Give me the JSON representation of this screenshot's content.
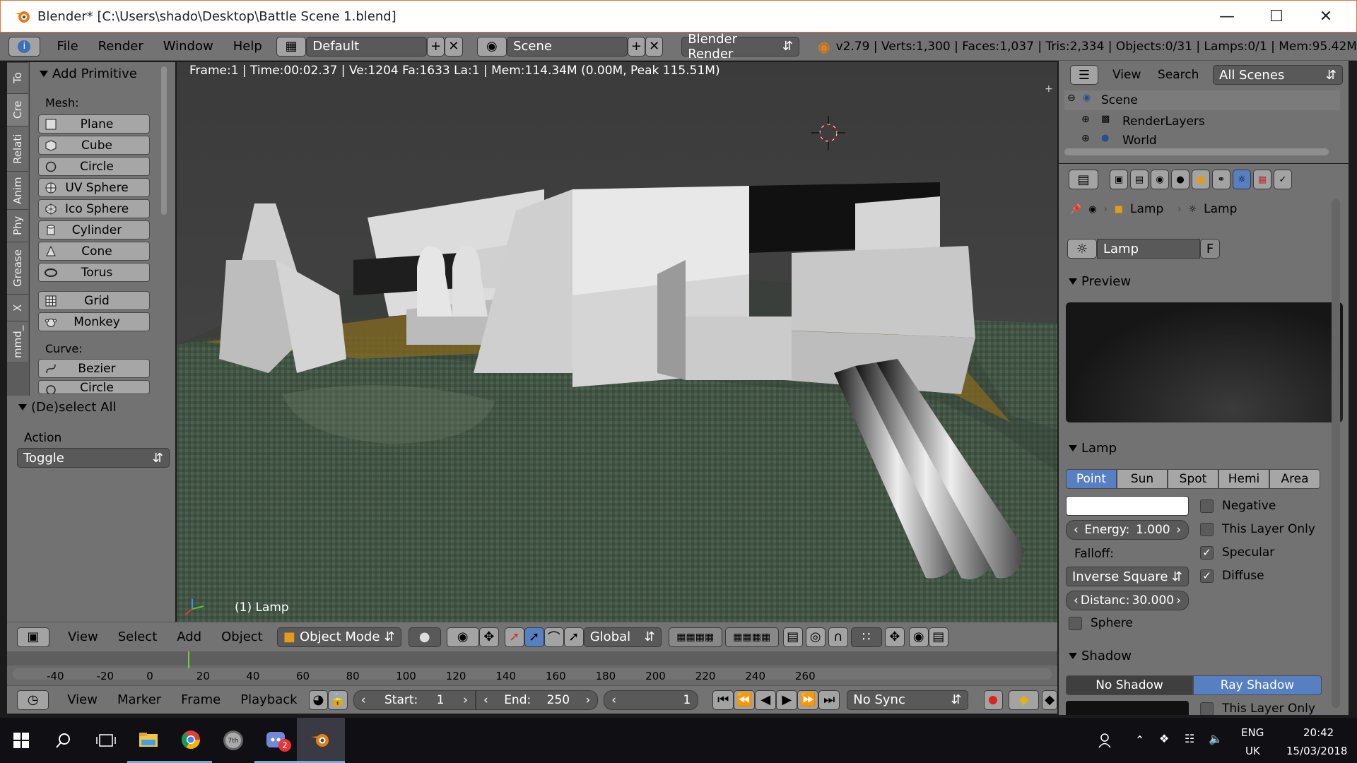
{
  "window": {
    "title": "Blender* [C:\\Users\\shado\\Desktop\\Battle Scene 1.blend]"
  },
  "info_header": {
    "menus": [
      "File",
      "Render",
      "Window",
      "Help"
    ],
    "layout": "Default",
    "scene": "Scene",
    "engine": "Blender Render",
    "stats": "v2.79 | Verts:1,300 | Faces:1,037 | Tris:2,334 | Objects:0/31 | Lamps:0/1 | Mem:95.42M"
  },
  "tool_tabs": [
    "To",
    "Cre",
    "Relati",
    "Anim",
    "Phy",
    "Grease",
    "X",
    "mmd_"
  ],
  "toolshelf": {
    "panel_title": "Add Primitive",
    "mesh_label": "Mesh:",
    "mesh_items": [
      "Plane",
      "Cube",
      "Circle",
      "UV Sphere",
      "Ico Sphere",
      "Cylinder",
      "Cone",
      "Torus"
    ],
    "extra_items": [
      "Grid",
      "Monkey"
    ],
    "curve_label": "Curve:",
    "curve_items": [
      "Bezier",
      "Circle"
    ]
  },
  "operator_panel": {
    "title": "(De)select All",
    "action_label": "Action",
    "action_value": "Toggle"
  },
  "viewport": {
    "info": "Frame:1 | Time:00:02.37 | Ve:1204 Fa:1633 La:1 | Mem:114.34M (0.00M, Peak 115.51M)",
    "active_object": "(1) Lamp"
  },
  "outliner": {
    "menus": [
      "View",
      "Search"
    ],
    "filter": "All Scenes",
    "items": [
      "Scene",
      "RenderLayers",
      "World"
    ]
  },
  "properties": {
    "breadcrumb": [
      "Lamp",
      "Lamp"
    ],
    "datablock": "Lamp",
    "fake_user": "F",
    "preview_title": "Preview",
    "lamp_title": "Lamp",
    "lamp_types": [
      "Point",
      "Sun",
      "Spot",
      "Hemi",
      "Area"
    ],
    "active_type": "Point",
    "energy_label": "Energy:",
    "energy_value": "1.000",
    "falloff_label": "Falloff:",
    "falloff_value": "Inverse Square",
    "distance_label": "Distanc:",
    "distance_value": "30.000",
    "checkboxes": [
      {
        "label": "Negative",
        "checked": false
      },
      {
        "label": "This Layer Only",
        "checked": false
      },
      {
        "label": "Specular",
        "checked": true
      },
      {
        "label": "Diffuse",
        "checked": true
      }
    ],
    "sphere_label": "Sphere",
    "shadow_title": "Shadow",
    "shadow_modes": [
      "No Shadow",
      "Ray Shadow"
    ],
    "active_shadow": "Ray Shadow",
    "shadow_extra": "This Layer Only"
  },
  "view3d_header": {
    "menus": [
      "View",
      "Select",
      "Add",
      "Object"
    ],
    "mode": "Object Mode",
    "orientation": "Global"
  },
  "timeline": {
    "ticks": [
      "-40",
      "-20",
      "0",
      "20",
      "40",
      "60",
      "80",
      "100",
      "120",
      "140",
      "160",
      "180",
      "200",
      "220",
      "240",
      "260"
    ],
    "current_frame": 0
  },
  "timeline_header": {
    "menus": [
      "View",
      "Marker",
      "Frame",
      "Playback"
    ],
    "start_label": "Start:",
    "start_value": "1",
    "end_label": "End:",
    "end_value": "250",
    "frame_value": "1",
    "sync": "No Sync"
  },
  "taskbar": {
    "lang_top": "ENG",
    "lang_bottom": "UK",
    "time": "20:42",
    "date": "15/03/2018",
    "discord_badge": "2"
  },
  "colors": {
    "accent_blue": "#5680c2",
    "blender_orange": "#e87d0d",
    "panel_gray": "#727272"
  }
}
